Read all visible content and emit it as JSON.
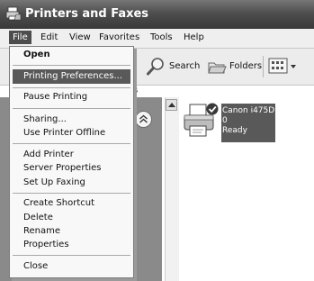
{
  "window": {
    "title": "Printers and Faxes"
  },
  "menubar": {
    "items": [
      "File",
      "Edit",
      "View",
      "Favorites",
      "Tools",
      "Help"
    ]
  },
  "toolbar": {
    "search_label": "Search",
    "folders_label": "Folders"
  },
  "address_fragment": "s",
  "printer": {
    "name": "Canon i475D",
    "documents": "0",
    "status": "Ready"
  },
  "file_menu": {
    "open": "Open",
    "printing_preferences": "Printing Preferences...",
    "pause_printing": "Pause Printing",
    "sharing": "Sharing...",
    "use_printer_offline": "Use Printer Offline",
    "add_printer": "Add Printer",
    "server_properties": "Server Properties",
    "set_up_faxing": "Set Up Faxing",
    "create_shortcut": "Create Shortcut",
    "delete": "Delete",
    "rename": "Rename",
    "properties": "Properties",
    "close": "Close"
  },
  "icons": {
    "title": "printer-folder-icon",
    "search": "magnifier-icon",
    "folders": "folder-tree-icon",
    "views": "views-grid-icon",
    "printer": "printer-icon",
    "default_marker": "checkmark-icon"
  }
}
